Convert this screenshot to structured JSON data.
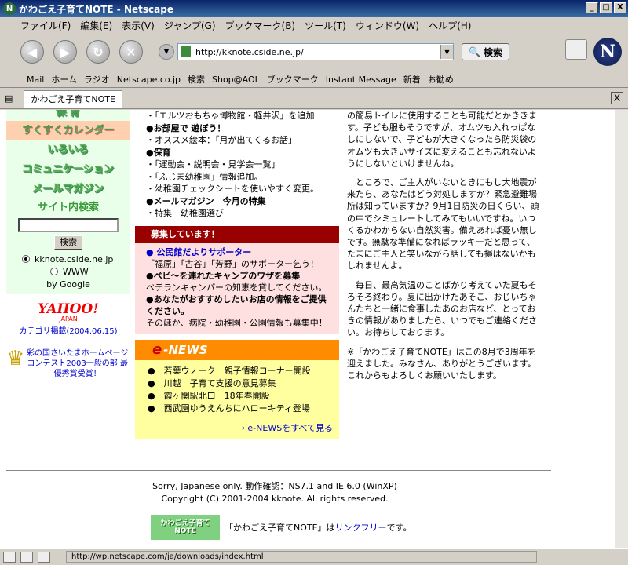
{
  "window": {
    "title": "かわごえ子育てNOTE - Netscape",
    "btn_min": "_",
    "btn_max": "□",
    "btn_close": "X"
  },
  "menu": [
    "ファイル(F)",
    "編集(E)",
    "表示(V)",
    "ジャンプ(G)",
    "ブックマーク(B)",
    "ツール(T)",
    "ウィンドウ(W)",
    "ヘルプ(H)"
  ],
  "nav": {
    "url": "http://kknote.cside.ne.jp/",
    "search_label": "検索"
  },
  "bookmarks": [
    "Mail",
    "ホーム",
    "ラジオ",
    "Netscape.co.jp",
    "検索",
    "Shop@AOL",
    "ブックマーク",
    "Instant Message",
    "新着",
    "お勧め"
  ],
  "tab": {
    "title": "かわごえ子育てNOTE",
    "close": "X"
  },
  "left": {
    "top_cut": "保 育",
    "calendar": "すくすくカレンダー",
    "items": [
      "いろいろ",
      "コミュニケーション",
      "メールマガジン"
    ],
    "search_title": "サイト内検索",
    "search_button": "検索",
    "radio_site": "kknote.cside.ne.jp",
    "radio_www": "WWW",
    "by_google": "by Google",
    "yahoo_logo": "YAHOO!",
    "yahoo_sub": "JAPAN",
    "yahoo_link": "カテゴリ掲載(2004.06.15)",
    "award": "彩の国さいたまホームページコンテスト2003一般の部 最優秀賞受賞！"
  },
  "middle": {
    "lines": [
      {
        "t": "・「エルツおもちゃ博物館・軽井沢」を追加",
        "b": false
      },
      {
        "t": "●お部屋で 遊ぼう！",
        "b": true
      },
      {
        "t": "・オススメ絵本：「月が出てくるお話」",
        "b": false
      },
      {
        "t": "●保育",
        "b": true
      },
      {
        "t": "・「運動会・説明会・見学会一覧」",
        "b": false
      },
      {
        "t": "・「ふじま幼稚園」情報追加。",
        "b": false
      },
      {
        "t": "・幼稚園チェックシートを使いやすく変更。",
        "b": false
      },
      {
        "t": "●メールマガジン　今月の特集",
        "b": true
      },
      {
        "t": "・特集　幼稚園選び",
        "b": false
      }
    ],
    "recruit_title": "募集しています！",
    "recruit1_title": "● 公民館だよりサポーター",
    "recruit1_body": "「福原」「古谷」「芳野」のサポーター乞う！",
    "recruit2_title": "●ベビ～を連れたキャンプのワザを募集",
    "recruit2_body": "ベテランキャンパーの知恵を貸してください。",
    "recruit3_title": "●あなたがおすすめしたいお店の情報をご提供ください。",
    "recruit3_body": "そのほか、病院・幼稚園・公園情報も募集中！",
    "enews_e": "e",
    "enews_title": "-NEWS",
    "news": [
      "●　若葉ウォーク　親子情報コーナー開設",
      "●　川越　子育て支援の意見募集",
      "●　霞ヶ関駅北口　18年春開設",
      "●　西武園ゆうえんちにハローキティ登場"
    ],
    "news_more": "→ e-NEWSをすべて見る"
  },
  "right": {
    "p1": "の簡易トイレに使用することも可能だとかききます。子ども服もそうですが、オムツも入れっぱなしにしないで、子どもが大きくなったら防災袋のオムツも大きいサイズに変えることも忘れないようにしないといけませんね。",
    "p2": "　ところで、ご主人がいないときにもし大地震が来たら、あなたはどう対処しますか？緊急避難場所は知っていますか？9月1日防災の日くらい、頭の中でシミュレートしてみてもいいですね。いつくるかわからない自然災害。備えあれば憂い無しです。無駄な準備になればラッキーだと思って、たまにご主人と笑いながら話しても損はないかもしれませんよ。",
    "p3": "　毎日、最高気温のことばかり考えていた夏もそろそろ終わり。夏に出かけたあそこ、おじいちゃんたちと一緒に食事したあのお店など、とっておきの情報がありましたら、いつでもご連絡ください。お待ちしております。",
    "p4": "※「かわごえ子育てNOTE」はこの8月で3周年を迎えました。みなさん、ありがとうございます。これからもよろしくお願いいたします。"
  },
  "footer": {
    "l1": "Sorry, Japanese only. 動作確認：NS7.1 and IE 6.0 (WinXP)",
    "l2": "Copyright (C) 2001-2004 kknote. All rights reserved.",
    "logo": "かわごえ子育てNOTE",
    "link_pre": "「かわごえ子育てNOTE」は",
    "link": "リンクフリー",
    "link_post": "です。"
  },
  "status": {
    "url": "http://wp.netscape.com/ja/downloads/index.html"
  }
}
